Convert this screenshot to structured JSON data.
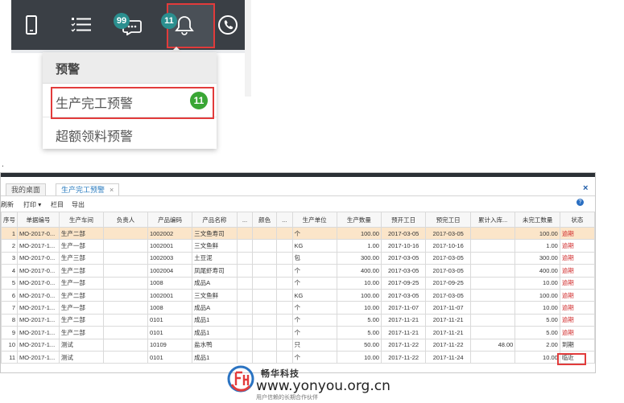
{
  "toolbar": {
    "chat_badge": "99",
    "bell_badge": "11",
    "colors": {
      "bar": "#3a3f45",
      "chat_badge": "#2b8f8f",
      "bell_badge": "#2b8f8f",
      "highlight": "#e23b3b"
    },
    "icons": [
      "tablet-icon",
      "list-icon",
      "chat-icon",
      "bell-icon",
      "phone-icon"
    ]
  },
  "dropdown": {
    "header": "预警",
    "items": [
      {
        "label": "生产完工预警",
        "badge": "11"
      },
      {
        "label": "超额领料预警"
      }
    ]
  },
  "dot": ".",
  "window": {
    "tabs": [
      {
        "label": "我的桌面",
        "active": false
      },
      {
        "label": "生产完工预警",
        "active": true
      }
    ],
    "close_symbol": "×",
    "tab_close_symbol": "×",
    "menu": {
      "refresh": "刷新",
      "print": "打印 ▾",
      "columns": "栏目",
      "export": "导出"
    },
    "help": "?",
    "columns": [
      "序号",
      "单据编号",
      "生产车间",
      "负责人",
      "产品编码",
      "产品名称",
      "...",
      "颜色",
      "...",
      "生产单位",
      "生产数量",
      "预开工日",
      "预完工日",
      "累计入库...",
      "未完工数量",
      "状态"
    ],
    "rows": [
      {
        "no": "1",
        "code": "MO-2017-0...",
        "workshop": "生产二部",
        "owner": "",
        "pcode": "1002002",
        "pname": "三文鱼寿司",
        "c1": "",
        "color": "",
        "c2": "",
        "unit": "个",
        "qty": "100.00",
        "start": "2017-03-05",
        "end": "2017-03-05",
        "stocked": "",
        "remain": "100.00",
        "status": "逾期"
      },
      {
        "no": "2",
        "code": "MO-2017-1...",
        "workshop": "生产一部",
        "owner": "",
        "pcode": "1002001",
        "pname": "三文鱼鲜",
        "c1": "",
        "color": "",
        "c2": "",
        "unit": "KG",
        "qty": "1.00",
        "start": "2017-10-16",
        "end": "2017-10-16",
        "stocked": "",
        "remain": "1.00",
        "status": "逾期"
      },
      {
        "no": "3",
        "code": "MO-2017-0...",
        "workshop": "生产三部",
        "owner": "",
        "pcode": "1002003",
        "pname": "土豆泥",
        "c1": "",
        "color": "",
        "c2": "",
        "unit": "包",
        "qty": "300.00",
        "start": "2017-03-05",
        "end": "2017-03-05",
        "stocked": "",
        "remain": "300.00",
        "status": "逾期"
      },
      {
        "no": "4",
        "code": "MO-2017-0...",
        "workshop": "生产二部",
        "owner": "",
        "pcode": "1002004",
        "pname": "凤尾虾寿司",
        "c1": "",
        "color": "",
        "c2": "",
        "unit": "个",
        "qty": "400.00",
        "start": "2017-03-05",
        "end": "2017-03-05",
        "stocked": "",
        "remain": "400.00",
        "status": "逾期"
      },
      {
        "no": "5",
        "code": "MO-2017-0...",
        "workshop": "生产一部",
        "owner": "",
        "pcode": "1008",
        "pname": "成品A",
        "c1": "",
        "color": "",
        "c2": "",
        "unit": "个",
        "qty": "10.00",
        "start": "2017-09-25",
        "end": "2017-09-25",
        "stocked": "",
        "remain": "10.00",
        "status": "逾期"
      },
      {
        "no": "6",
        "code": "MO-2017-0...",
        "workshop": "生产二部",
        "owner": "",
        "pcode": "1002001",
        "pname": "三文鱼鲜",
        "c1": "",
        "color": "",
        "c2": "",
        "unit": "KG",
        "qty": "100.00",
        "start": "2017-03-05",
        "end": "2017-03-05",
        "stocked": "",
        "remain": "100.00",
        "status": "逾期"
      },
      {
        "no": "7",
        "code": "MO-2017-1...",
        "workshop": "生产一部",
        "owner": "",
        "pcode": "1008",
        "pname": "成品A",
        "c1": "",
        "color": "",
        "c2": "",
        "unit": "个",
        "qty": "10.00",
        "start": "2017-11-07",
        "end": "2017-11-07",
        "stocked": "",
        "remain": "10.00",
        "status": "逾期"
      },
      {
        "no": "8",
        "code": "MO-2017-1...",
        "workshop": "生产二部",
        "owner": "",
        "pcode": "0101",
        "pname": "成品1",
        "c1": "",
        "color": "",
        "c2": "",
        "unit": "个",
        "qty": "5.00",
        "start": "2017-11-21",
        "end": "2017-11-21",
        "stocked": "",
        "remain": "5.00",
        "status": "逾期"
      },
      {
        "no": "9",
        "code": "MO-2017-1...",
        "workshop": "生产二部",
        "owner": "",
        "pcode": "0101",
        "pname": "成品1",
        "c1": "",
        "color": "",
        "c2": "",
        "unit": "个",
        "qty": "5.00",
        "start": "2017-11-21",
        "end": "2017-11-21",
        "stocked": "",
        "remain": "5.00",
        "status": "逾期"
      },
      {
        "no": "10",
        "code": "MO-2017-1...",
        "workshop": "测试",
        "owner": "",
        "pcode": "10109",
        "pname": "盐水鸭",
        "c1": "",
        "color": "",
        "c2": "",
        "unit": "只",
        "qty": "50.00",
        "start": "2017-11-22",
        "end": "2017-11-22",
        "stocked": "48.00",
        "remain": "2.00",
        "status": "到期"
      },
      {
        "no": "11",
        "code": "MO-2017-1...",
        "workshop": "测试",
        "owner": "",
        "pcode": "0101",
        "pname": "成品1",
        "c1": "",
        "color": "",
        "c2": "",
        "unit": "个",
        "qty": "10.00",
        "start": "2017-11-22",
        "end": "2017-11-24",
        "stocked": "",
        "remain": "10.00",
        "status": "临近"
      }
    ]
  },
  "watermark": {
    "title": "畅华科技",
    "url": "www.yonyou.org.cn",
    "subtitle": "用户信赖的长期合作伙伴"
  }
}
